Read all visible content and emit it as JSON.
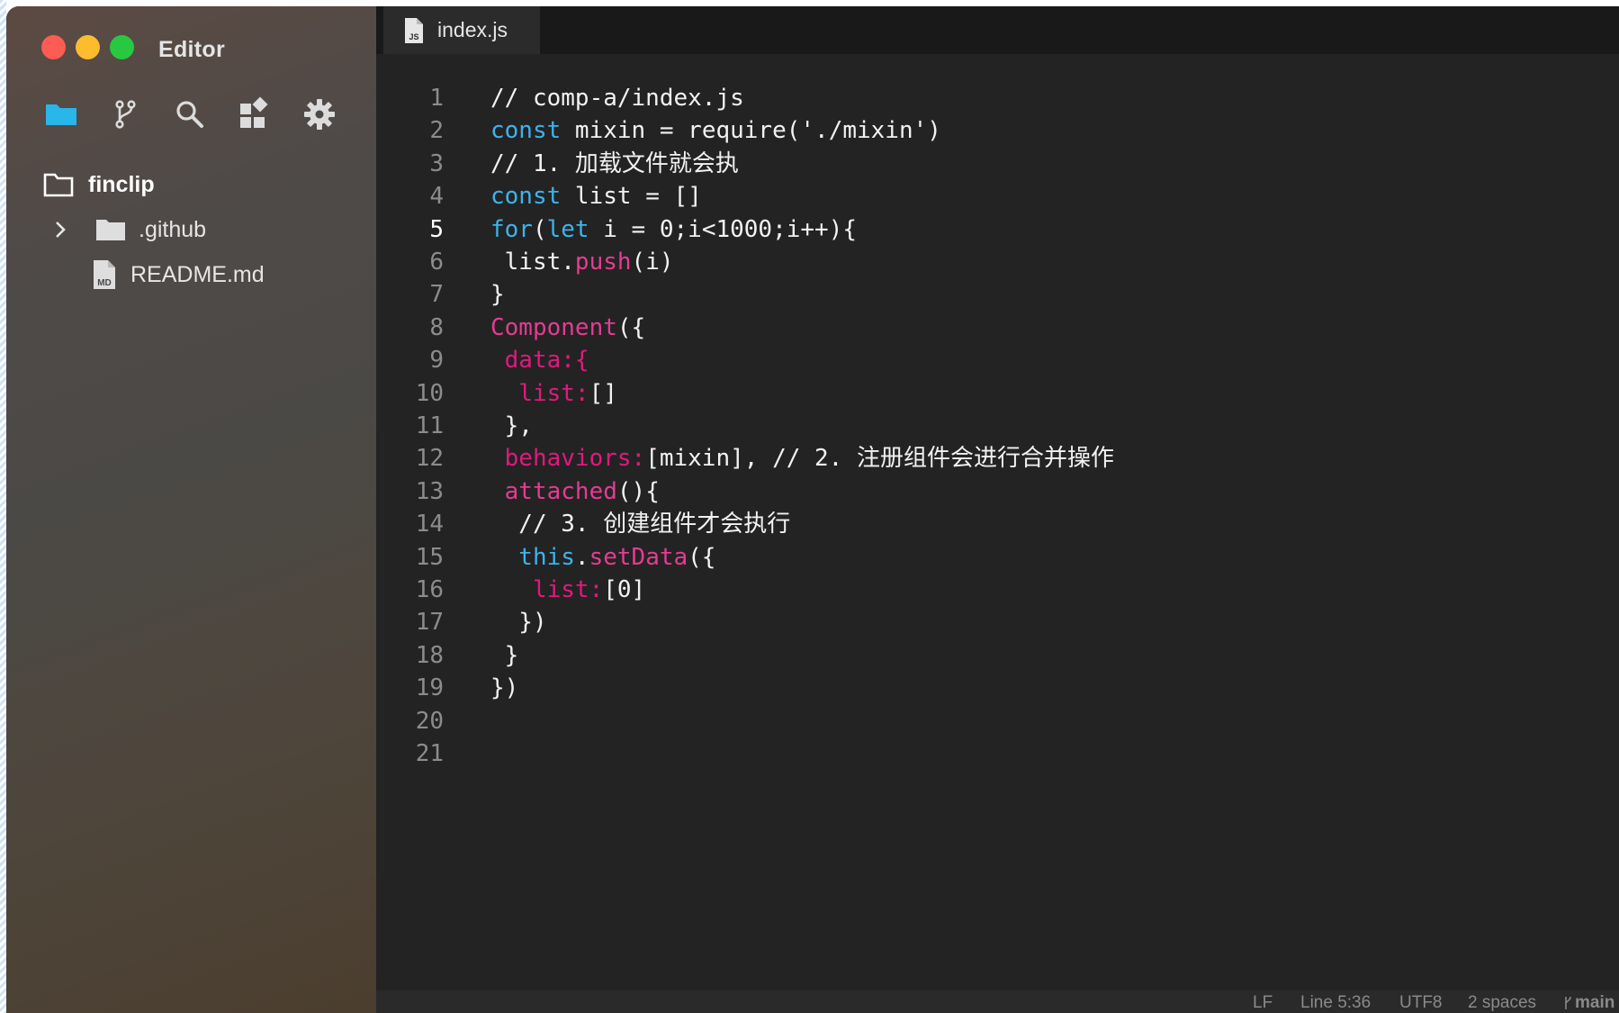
{
  "window": {
    "title": "Editor"
  },
  "sidebar": {
    "toolbar": [
      {
        "name": "explorer",
        "icon": "folder-icon",
        "active": true
      },
      {
        "name": "source-control",
        "icon": "git-branch-icon"
      },
      {
        "name": "search",
        "icon": "search-icon"
      },
      {
        "name": "extensions",
        "icon": "extensions-icon"
      },
      {
        "name": "settings",
        "icon": "gear-icon"
      }
    ],
    "tree": {
      "root": {
        "label": "finclip",
        "icon": "folder-outline-icon"
      },
      "items": [
        {
          "label": ".github",
          "type": "folder",
          "icon": "folder-icon",
          "expandable": true
        },
        {
          "label": "README.md",
          "type": "file",
          "icon": "markdown-file-icon",
          "badge": "MD"
        }
      ]
    }
  },
  "editor": {
    "tabs": [
      {
        "label": "index.js",
        "icon": "js-file-icon",
        "badge": "JS",
        "active": true
      }
    ],
    "current_line": 5,
    "lines": [
      {
        "n": "1",
        "tokens": [
          {
            "t": "// comp-a/index.js",
            "k": "comment"
          }
        ]
      },
      {
        "n": "2",
        "tokens": [
          {
            "t": "const",
            "k": "kw"
          },
          {
            "t": " mixin = require('./mixin')",
            "k": "plain"
          }
        ]
      },
      {
        "n": "3",
        "tokens": [
          {
            "t": "// 1. 加载文件就会执",
            "k": "comment"
          }
        ]
      },
      {
        "n": "4",
        "tokens": [
          {
            "t": "const",
            "k": "kw"
          },
          {
            "t": " list = []",
            "k": "plain"
          }
        ]
      },
      {
        "n": "5",
        "tokens": [
          {
            "t": "for",
            "k": "kw"
          },
          {
            "t": "(",
            "k": "plain"
          },
          {
            "t": "let",
            "k": "kw"
          },
          {
            "t": " i = 0;i<1000;i++){",
            "k": "plain"
          }
        ]
      },
      {
        "n": "6",
        "tokens": [
          {
            "t": " list.",
            "k": "plain"
          },
          {
            "t": "push",
            "k": "fn"
          },
          {
            "t": "(i)",
            "k": "plain"
          }
        ]
      },
      {
        "n": "7",
        "tokens": [
          {
            "t": "}",
            "k": "plain"
          }
        ]
      },
      {
        "n": "8",
        "tokens": [
          {
            "t": "Component",
            "k": "fn"
          },
          {
            "t": "({",
            "k": "plain"
          }
        ]
      },
      {
        "n": "9",
        "tokens": [
          {
            "t": " data:{",
            "k": "prop"
          }
        ]
      },
      {
        "n": "10",
        "tokens": [
          {
            "t": "  list:",
            "k": "prop"
          },
          {
            "t": "[]",
            "k": "plain"
          }
        ]
      },
      {
        "n": "11",
        "tokens": [
          {
            "t": " },",
            "k": "plain"
          }
        ]
      },
      {
        "n": "12",
        "tokens": [
          {
            "t": " behaviors:",
            "k": "prop"
          },
          {
            "t": "[mixin], // 2. 注册组件会进行合并操作",
            "k": "plain"
          }
        ]
      },
      {
        "n": "13",
        "tokens": [
          {
            "t": " attached",
            "k": "fn"
          },
          {
            "t": "(){",
            "k": "plain"
          }
        ]
      },
      {
        "n": "14",
        "tokens": [
          {
            "t": "  // 3. 创建组件才会执行",
            "k": "comment"
          }
        ]
      },
      {
        "n": "15",
        "tokens": [
          {
            "t": "  this",
            "k": "kw"
          },
          {
            "t": ".",
            "k": "plain"
          },
          {
            "t": "setData",
            "k": "fn"
          },
          {
            "t": "({",
            "k": "plain"
          }
        ]
      },
      {
        "n": "16",
        "tokens": [
          {
            "t": "   list:",
            "k": "prop"
          },
          {
            "t": "[0]",
            "k": "plain"
          }
        ]
      },
      {
        "n": "17",
        "tokens": [
          {
            "t": "  })",
            "k": "plain"
          }
        ]
      },
      {
        "n": "18",
        "tokens": [
          {
            "t": " }",
            "k": "plain"
          }
        ]
      },
      {
        "n": "19",
        "tokens": [
          {
            "t": "})",
            "k": "plain"
          }
        ]
      },
      {
        "n": "20",
        "tokens": []
      },
      {
        "n": "21",
        "tokens": []
      }
    ]
  },
  "statusbar": {
    "line_ending": "LF",
    "cursor": "Line 5:36",
    "encoding": "UTF8",
    "indent": "2 spaces",
    "branch": "main",
    "branch_icon": "git-branch-icon"
  },
  "colors": {
    "accent": "#29b6e8",
    "keyword": "#3db3ec",
    "function": "#e63b92",
    "property": "#e0197e",
    "close": "#fd5c55",
    "minimize": "#fdbc2e",
    "maximize": "#28c841"
  }
}
